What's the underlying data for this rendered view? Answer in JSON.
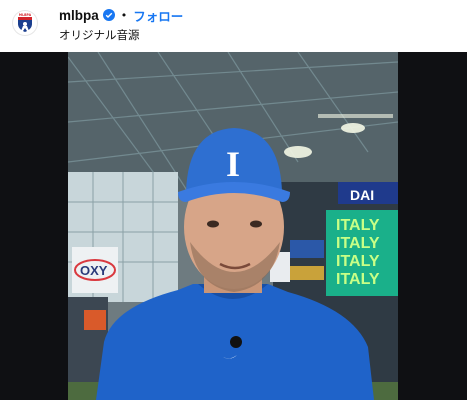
{
  "post_header": {
    "username": "mlbpa",
    "separator": "•",
    "follow_label": "フォロー",
    "audio_label": "オリジナル音源",
    "avatar_logo_text": "MLBPA",
    "verified_icon": "verified-badge-icon"
  },
  "video": {
    "scoreboard_lines": [
      "ITALY",
      "ITALY",
      "ITALY",
      "ITALY"
    ],
    "ad_text": "OXY",
    "banner_text": "DAI",
    "cap_letter": "I",
    "colors": {
      "jersey": "#1f63c9",
      "scoreboard": "#1ab08a",
      "follow": "#1877f2"
    }
  }
}
